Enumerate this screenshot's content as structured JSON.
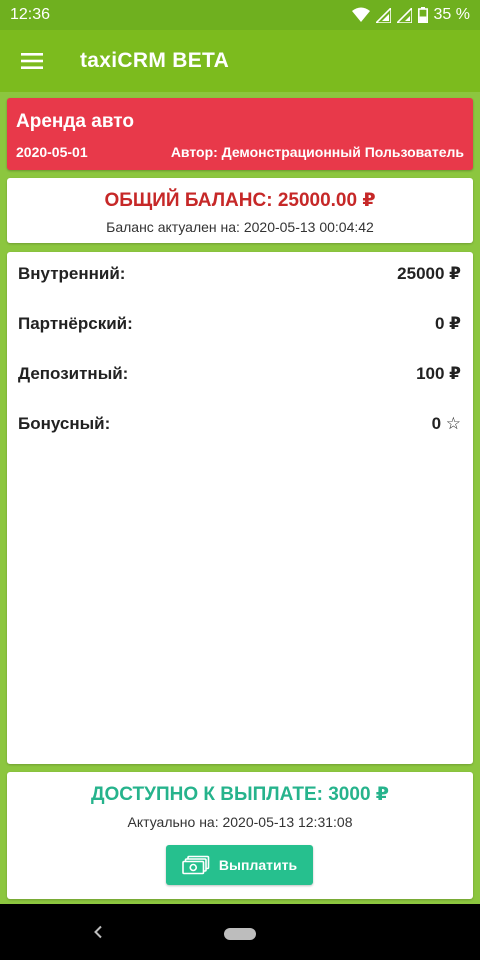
{
  "status_bar": {
    "time": "12:36",
    "battery": "35 %"
  },
  "app_bar": {
    "title": "taxiCRM BETA",
    "menu_icon": "hamburger-menu-icon"
  },
  "rental_card": {
    "title": "Аренда авто",
    "date": "2020-05-01",
    "author": "Автор: Демонстрационный Пользователь",
    "color": "#e8394a"
  },
  "balance": {
    "total": "ОБЩИЙ БАЛАНС: 25000.00 ₽",
    "updated": "Баланс актуален на: 2020-05-13 00:04:42",
    "color": "#c62828"
  },
  "accounts": [
    {
      "label": "Внутренний:",
      "value": "25000 ₽"
    },
    {
      "label": "Партнёрский:",
      "value": "0 ₽"
    },
    {
      "label": "Депозитный:",
      "value": "100 ₽"
    },
    {
      "label": "Бонусный:",
      "value": "0 ☆"
    }
  ],
  "payout": {
    "title": "ДОСТУПНО К ВЫПЛАТЕ: 3000 ₽",
    "updated": "Актуально на: 2020-05-13 12:31:08",
    "button_label": "Выплатить",
    "button_icon": "money-icon",
    "color": "#26b38c"
  },
  "theme": {
    "app_bar": "#7cbb1e",
    "background": "#8cc63f"
  }
}
